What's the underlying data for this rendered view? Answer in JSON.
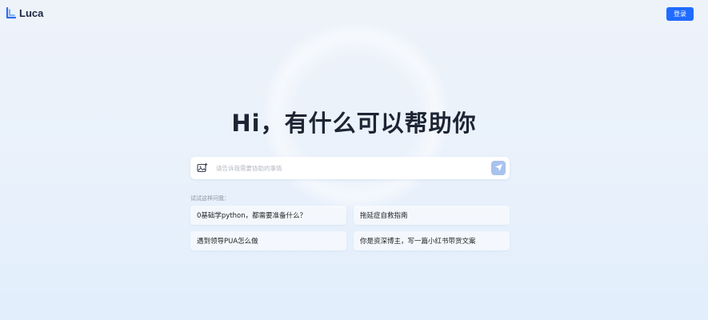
{
  "header": {
    "logo_text": "Luca",
    "login_label": "登录"
  },
  "hero": {
    "title": "Hi，有什么可以帮助你"
  },
  "search": {
    "placeholder": "请告诉我需要协助的事情"
  },
  "suggestions": {
    "label": "试试这样问我：",
    "items": [
      {
        "label": "0基础学python，都需要准备什么？"
      },
      {
        "label": "拖延症自救指南"
      },
      {
        "label": "遇到领导PUA怎么做"
      },
      {
        "label": "你是资深博主，写一篇小红书带货文案"
      }
    ]
  },
  "colors": {
    "accent": "#1f6bff",
    "send_button": "#a9c2ee"
  },
  "icons": {
    "logo": "luca-logo-icon",
    "image_upload": "image-upload-icon",
    "send": "send-icon"
  }
}
